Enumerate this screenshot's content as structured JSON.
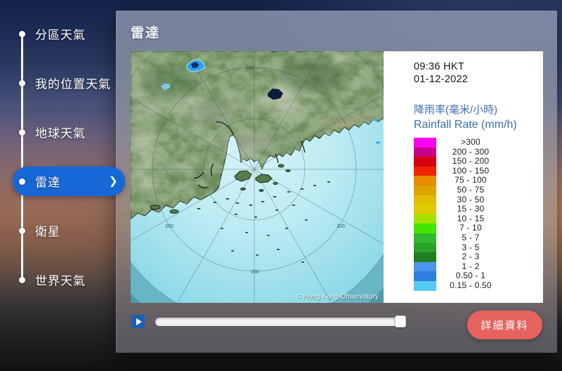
{
  "sidebar": {
    "selected_color": "#1668d6",
    "items": [
      {
        "label": "分區天氣",
        "selected": false
      },
      {
        "label": "我的位置天氣",
        "selected": false
      },
      {
        "label": "地球天氣",
        "selected": false
      },
      {
        "label": "雷達",
        "selected": true
      },
      {
        "label": "衛星",
        "selected": false
      },
      {
        "label": "世界天氣",
        "selected": false
      }
    ]
  },
  "panel": {
    "title": "雷達"
  },
  "radar": {
    "timestamp_time": "09:36 HKT",
    "timestamp_date": "01-12-2022",
    "rate_label_zh": "降雨率(毫米/小時)",
    "rate_label_en": "Rainfall Rate (mm/h)",
    "legend_title_color": "#3e6fae",
    "ring_label": "200",
    "copyright": "© Hong Kong Observatory",
    "scale": [
      {
        "label": ">300",
        "color": "#fa00f2"
      },
      {
        "label": "200 - 300",
        "color": "#c8008c"
      },
      {
        "label": "150 - 200",
        "color": "#d80010"
      },
      {
        "label": "100 - 150",
        "color": "#ee2400"
      },
      {
        "label": "75 - 100",
        "color": "#e68a00"
      },
      {
        "label": "50 - 75",
        "color": "#dda400"
      },
      {
        "label": "30 - 50",
        "color": "#e0bd00"
      },
      {
        "label": "15 - 30",
        "color": "#dccb00"
      },
      {
        "label": "10 - 15",
        "color": "#a4e100"
      },
      {
        "label": "7 - 10",
        "color": "#43e600"
      },
      {
        "label": "5 - 7",
        "color": "#31b831"
      },
      {
        "label": "3 - 5",
        "color": "#2aa32a"
      },
      {
        "label": "2 - 3",
        "color": "#1f7f1f"
      },
      {
        "label": "1 - 2",
        "color": "#4d94ec"
      },
      {
        "label": "0.50 - 1",
        "color": "#2e7fe0"
      },
      {
        "label": "0.15 - 0.50",
        "color": "#55c8f0"
      }
    ]
  },
  "controls": {
    "play_icon": "play-triangle",
    "slider_value_percent": 99,
    "details_button_label": "詳細資料",
    "details_button_color": "#e4635e"
  }
}
